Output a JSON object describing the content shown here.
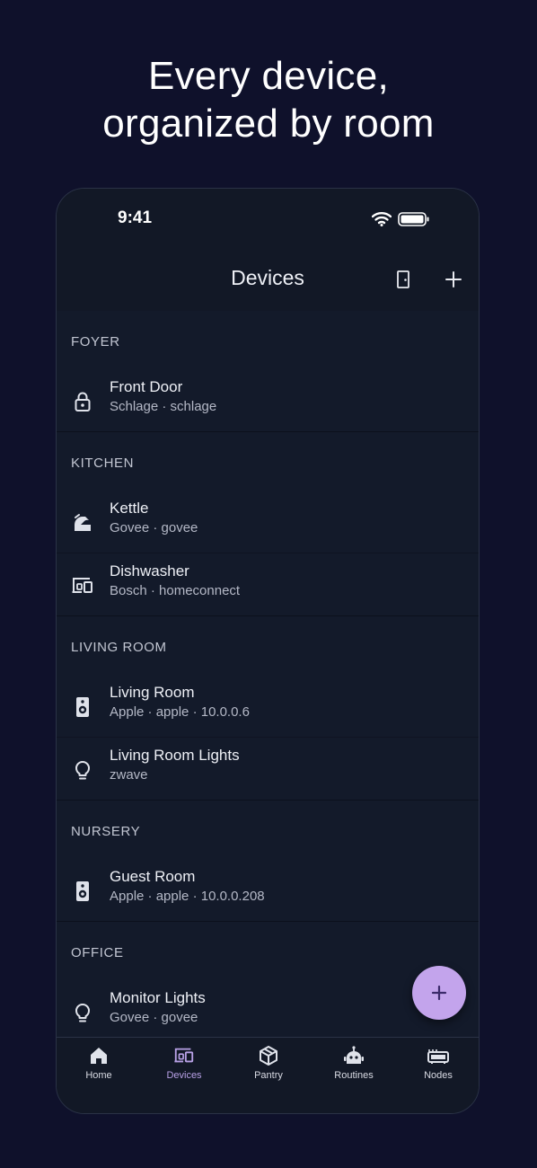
{
  "headline": {
    "line1": "Every device,",
    "line2": "organized by room"
  },
  "status_bar": {
    "time": "9:41"
  },
  "app_bar": {
    "title": "Devices"
  },
  "sections": [
    {
      "title": "FOYER",
      "devices": [
        {
          "name": "Front Door",
          "subtitle": "Schlage · schlage",
          "icon": "lock-icon"
        }
      ]
    },
    {
      "title": "KITCHEN",
      "devices": [
        {
          "name": "Kettle",
          "subtitle": "Govee · govee",
          "icon": "kettle-icon"
        },
        {
          "name": "Dishwasher",
          "subtitle": "Bosch · homeconnect",
          "icon": "devices-icon"
        }
      ]
    },
    {
      "title": "LIVING ROOM",
      "devices": [
        {
          "name": "Living Room",
          "subtitle": "Apple · apple · 10.0.0.6",
          "icon": "speaker-icon"
        },
        {
          "name": "Living Room Lights",
          "subtitle": "zwave",
          "icon": "lightbulb-icon"
        }
      ]
    },
    {
      "title": "NURSERY",
      "devices": [
        {
          "name": "Guest Room",
          "subtitle": "Apple · apple · 10.0.0.208",
          "icon": "speaker-icon"
        }
      ]
    },
    {
      "title": "OFFICE",
      "devices": [
        {
          "name": "Monitor Lights",
          "subtitle": "Govee · govee",
          "icon": "lightbulb-icon"
        }
      ]
    }
  ],
  "tabs": [
    {
      "label": "Home",
      "icon": "home-icon",
      "active": false
    },
    {
      "label": "Devices",
      "icon": "devices-icon",
      "active": true
    },
    {
      "label": "Pantry",
      "icon": "box-icon",
      "active": false
    },
    {
      "label": "Routines",
      "icon": "robot-icon",
      "active": false
    },
    {
      "label": "Nodes",
      "icon": "router-icon",
      "active": false
    }
  ],
  "colors": {
    "background": "#0f112b",
    "surface": "#131a2a",
    "accent": "#c3a4ec",
    "active_tab": "#b8a1e6"
  }
}
